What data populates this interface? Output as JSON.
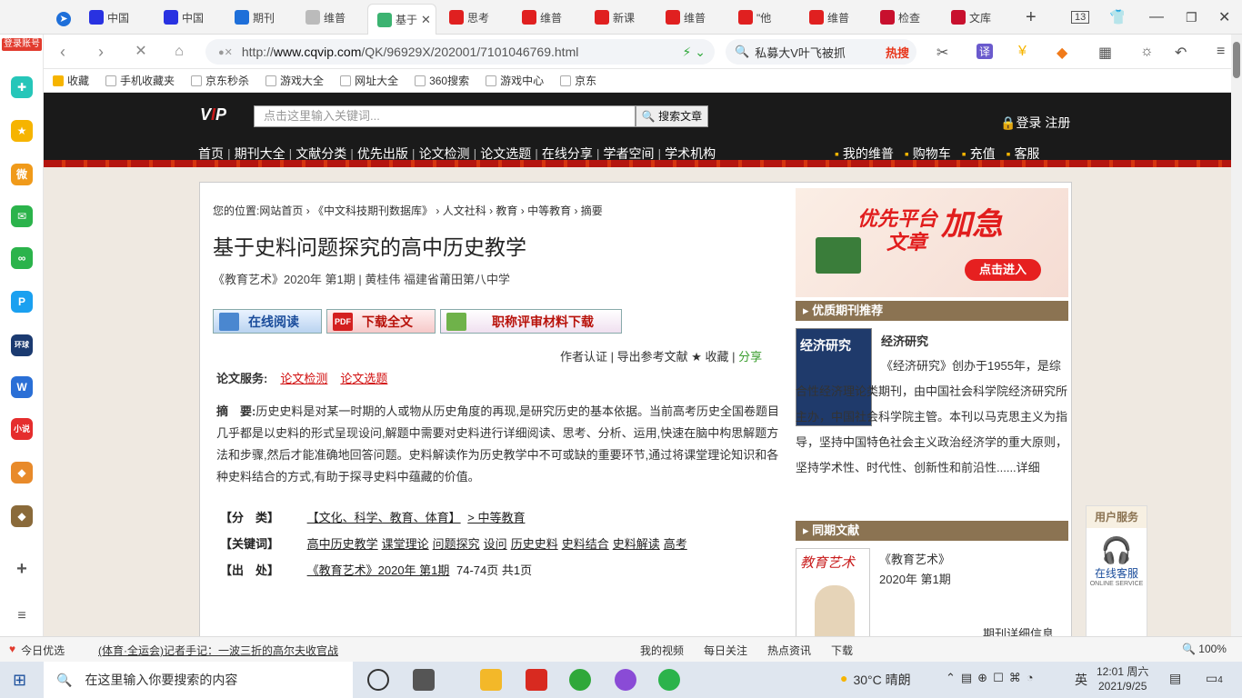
{
  "browser": {
    "tabs": [
      {
        "label": "中国",
        "icon": "baidu-icon",
        "color": "#2932e1"
      },
      {
        "label": "中国",
        "icon": "baidu-icon",
        "color": "#2932e1"
      },
      {
        "label": "期刊",
        "icon": "browser-icon",
        "color": "#1e6fd9"
      },
      {
        "label": "维普",
        "icon": "page-icon",
        "color": "#bbb"
      },
      {
        "label": "基于",
        "icon": "loading-icon",
        "color": "#3cb371"
      },
      {
        "label": "思考",
        "icon": "v-icon",
        "color": "#e02020"
      },
      {
        "label": "维普",
        "icon": "v-icon",
        "color": "#e02020"
      },
      {
        "label": "新课",
        "icon": "v-icon",
        "color": "#e02020"
      },
      {
        "label": "维普",
        "icon": "v-icon",
        "color": "#e02020"
      },
      {
        "label": "\"他",
        "icon": "v-icon",
        "color": "#e02020"
      },
      {
        "label": "维普",
        "icon": "v-icon",
        "color": "#e02020"
      },
      {
        "label": "检查",
        "icon": "zhi-icon",
        "color": "#c8102e"
      },
      {
        "label": "文库",
        "icon": "doc-icon",
        "color": "#c8102e"
      }
    ],
    "tab_count": "13",
    "url_prefix": "http://",
    "url_domain": "www.cqvip.com",
    "url_path": "/QK/96929X/202001/7101046769.html",
    "search_query": "私募大V叶飞被抓",
    "hot_label": "热搜",
    "bookmarks": [
      "收藏",
      "手机收藏夹",
      "京东秒杀",
      "游戏大全",
      "网址大全",
      "360搜索",
      "游戏中心",
      "京东"
    ],
    "login_badge": "登录账号"
  },
  "site": {
    "search_placeholder": "点击这里输入关键词...",
    "search_button": "搜索文章",
    "login_register": "登录 注册",
    "nav": [
      "首页",
      "期刊大全",
      "文献分类",
      "优先出版",
      "论文检测",
      "论文选题",
      "在线分享",
      "学者空间",
      "学术机构"
    ],
    "user_nav": [
      "我的维普",
      "购物车",
      "充值",
      "客服"
    ]
  },
  "article": {
    "breadcrumb": [
      "您的位置:",
      "网站首页",
      "《中文科技期刊数据库》",
      "人文社科",
      "教育",
      "中等教育",
      "摘要"
    ],
    "title": "基于史料问题探究的高中历史教学",
    "meta": "《教育艺术》2020年 第1期 | 黄桂伟   福建省莆田第八中学",
    "buttons": {
      "read": "在线阅读",
      "download": "下载全文",
      "title_eval": "职称评审材料下载"
    },
    "tools": {
      "auth": "作者认证",
      "export": "导出参考文献",
      "collect": "★ 收藏",
      "share": "分享"
    },
    "service_label": "论文服务:",
    "service_links": [
      "论文检测",
      "论文选题"
    ],
    "abstract_label": "摘　要:",
    "abstract": "历史史料是对某一时期的人或物从历史角度的再现,是研究历史的基本依据。当前高考历史全国卷题目几乎都是以史料的形式呈现设问,解题中需要对史料进行详细阅读、思考、分析、运用,快速在脑中构思解题方法和步骤,然后才能准确地回答问题。史料解读作为历史教学中不可或缺的重要环节,通过将课堂理论知识和各种史料结合的方式,有助于探寻史料中蕴藏的价值。",
    "classification_label": "【分　类】",
    "classification": "【文化、科学、教育、体育】",
    "classification_sub": "> 中等教育",
    "keywords_label": "【关键词】",
    "keywords": [
      "高中历史教学",
      "课堂理论",
      "问题探究",
      "设问",
      "历史史料",
      "史料结合",
      "史料解读",
      "高考"
    ],
    "source_label": "【出　处】",
    "source": "《教育艺术》2020年 第1期",
    "source_pages": "74-74页 共1页"
  },
  "sidebar_right": {
    "ad": {
      "line1": "优先平台",
      "line2": "加急",
      "line3": "文章",
      "button": "点击进入"
    },
    "quality_head": "优质期刊推荐",
    "journal_title": "经济研究",
    "journal_cover_text": "经济研究",
    "journal_desc": "《经济研究》创办于1955年，是综合性经济理论类期刊，由中国社会科学院经济研究所主办，中国社会科学院主管。本刊以马克思主义为指导，坚持中国特色社会主义政治经济学的重大原则，坚持学术性、时代性、创新性和前沿性......详细",
    "same_head": "同期文献",
    "same_journal": "《教育艺术》",
    "same_issue": "2020年 第1期",
    "same_detail": "期刊详细信息"
  },
  "user_service": {
    "head": "用户服务",
    "label": "在线客服",
    "sub": "ONLINE SERVICE"
  },
  "statusbar": {
    "left_label": "今日优选",
    "news": "(体育·全运会)记者手记：一波三折的高尔夫收官战",
    "items": [
      "我的视频",
      "每日关注",
      "热点资讯",
      "下载"
    ],
    "zoom": "100%"
  },
  "taskbar": {
    "search_placeholder": "在这里输入你要搜索的内容",
    "weather": "30°C 晴朗",
    "ime": "英",
    "time": "12:01 周六",
    "date": "2021/9/25",
    "notif": "4"
  }
}
